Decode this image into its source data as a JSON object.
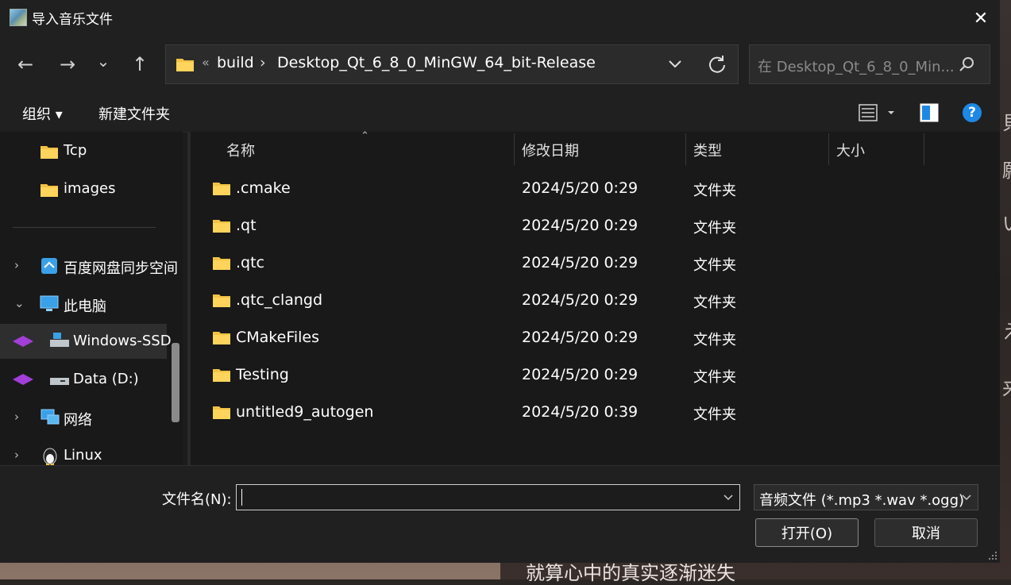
{
  "window": {
    "title": "导入音乐文件",
    "close_glyph": "✕"
  },
  "background": {
    "lyric": "就算心中的真实逐渐迷失"
  },
  "nav": {
    "back_glyph": "←",
    "forward_glyph": "→",
    "recent_glyph": "⌄",
    "up_glyph": "↑"
  },
  "address": {
    "overflow": "«",
    "crumbs": [
      "build",
      "Desktop_Qt_6_8_0_MinGW_64_bit-Release"
    ],
    "separator": "›"
  },
  "search": {
    "placeholder": "在 Desktop_Qt_6_8_0_Min..."
  },
  "commands": {
    "organize": "组织 ▾",
    "new_folder": "新建文件夹",
    "help": "?"
  },
  "sidebar": {
    "items": [
      {
        "label": "Tcp",
        "icon": "folder-icon"
      },
      {
        "label": "images",
        "icon": "folder-icon"
      },
      {
        "label": "百度网盘同步空间",
        "icon": "baidu-sync-icon",
        "chevron": "›"
      },
      {
        "label": "此电脑",
        "icon": "computer-icon",
        "chevron": "⌄"
      },
      {
        "label": "Windows-SSD",
        "icon": "drive-icon"
      },
      {
        "label": "Data (D:)",
        "icon": "drive-icon"
      },
      {
        "label": "网络",
        "icon": "network-icon",
        "chevron": "›"
      },
      {
        "label": "Linux",
        "icon": "linux-icon",
        "chevron": "›"
      }
    ]
  },
  "columns": {
    "name": "名称",
    "date": "修改日期",
    "type": "类型",
    "size": "大小",
    "sort_glyph": "⌃"
  },
  "files": [
    {
      "name": ".cmake",
      "date": "2024/5/20 0:29",
      "type": "文件夹"
    },
    {
      "name": ".qt",
      "date": "2024/5/20 0:29",
      "type": "文件夹"
    },
    {
      "name": ".qtc",
      "date": "2024/5/20 0:29",
      "type": "文件夹"
    },
    {
      "name": ".qtc_clangd",
      "date": "2024/5/20 0:29",
      "type": "文件夹"
    },
    {
      "name": "CMakeFiles",
      "date": "2024/5/20 0:29",
      "type": "文件夹"
    },
    {
      "name": "Testing",
      "date": "2024/5/20 0:29",
      "type": "文件夹"
    },
    {
      "name": "untitled9_autogen",
      "date": "2024/5/20 0:39",
      "type": "文件夹"
    }
  ],
  "footer": {
    "filename_label": "文件名(N):",
    "filename_value": "",
    "filetype": "音频文件 (*.mp3 *.wav *.ogg)",
    "open": "打开(O)",
    "cancel": "取消"
  },
  "colors": {
    "dialog": "#1c1c1c",
    "chrome": "#202020",
    "folder": "#f3c244",
    "accent": "#1e88e5"
  }
}
